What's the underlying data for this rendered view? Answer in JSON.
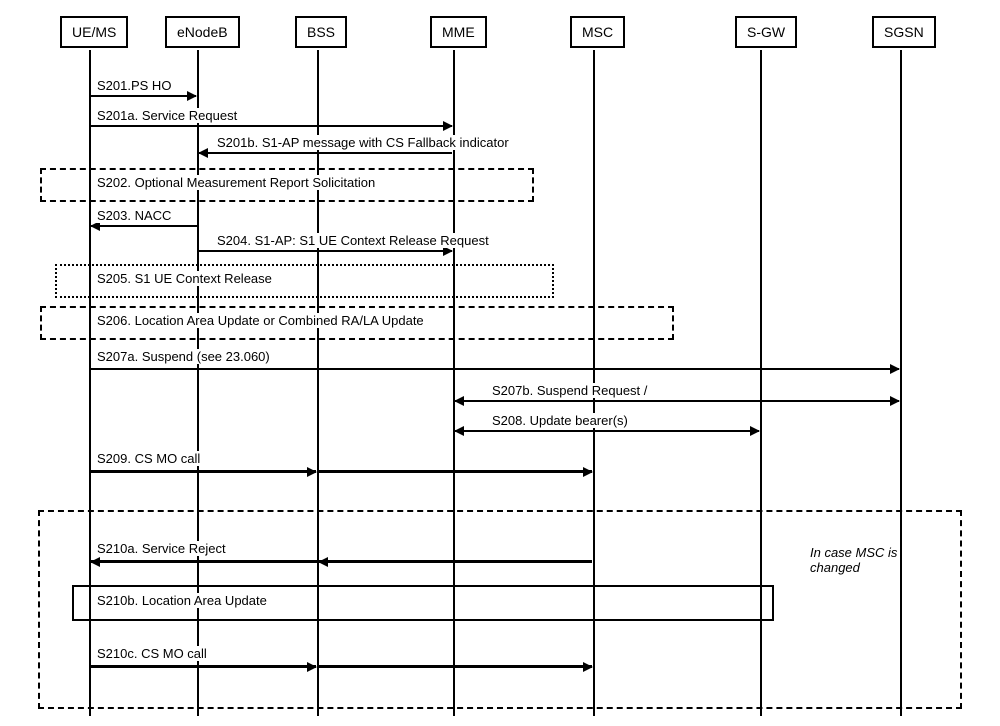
{
  "participants": {
    "ue": "UE/MS",
    "enb": "eNodeB",
    "bss": "BSS",
    "mme": "MME",
    "msc": "MSC",
    "sgw": "S-GW",
    "sgsn": "SGSN"
  },
  "messages": {
    "s201": "S201.PS HO",
    "s201a": "S201a. Service Request",
    "s201b": "S201b. S1-AP message with CS Fallback indicator",
    "s202": "S202. Optional Measurement Report Solicitation",
    "s203": "S203. NACC",
    "s204": "S204. S1-AP: S1 UE Context Release Request",
    "s205": "S205. S1 UE Context Release",
    "s206": "S206. Location Area Update or Combined RA/LA Update",
    "s207a": "S207a. Suspend (see 23.060)",
    "s207b": "S207b. Suspend Request /",
    "s208": "S208. Update bearer(s)",
    "s209": "S209. CS MO call",
    "s210a": "S210a. Service Reject",
    "s210b": "S210b. Location Area Update",
    "s210c": "S210c. CS MO call"
  },
  "notes": {
    "msc_changed": "In case MSC is changed"
  },
  "chart_data": {
    "type": "sequence_diagram",
    "participants": [
      "UE/MS",
      "eNodeB",
      "BSS",
      "MME",
      "MSC",
      "S-GW",
      "SGSN"
    ],
    "interactions": [
      {
        "id": "S201",
        "from": "UE/MS",
        "to": "eNodeB",
        "label": "S201.PS HO",
        "direction": "right"
      },
      {
        "id": "S201a",
        "from": "UE/MS",
        "to": "MME",
        "label": "S201a. Service Request",
        "direction": "right",
        "via": "eNodeB"
      },
      {
        "id": "S201b",
        "from": "MME",
        "to": "eNodeB",
        "label": "S201b. S1-AP message with CS Fallback indicator",
        "direction": "left"
      },
      {
        "id": "S202",
        "box": true,
        "span": [
          "UE/MS",
          "MME"
        ],
        "label": "S202. Optional Measurement Report Solicitation",
        "style": "dashed"
      },
      {
        "id": "S203",
        "from": "eNodeB",
        "to": "UE/MS",
        "label": "S203. NACC",
        "direction": "left"
      },
      {
        "id": "S204",
        "from": "eNodeB",
        "to": "MME",
        "label": "S204. S1-AP: S1 UE Context Release Request",
        "direction": "right"
      },
      {
        "id": "S205",
        "box": true,
        "span": [
          "UE/MS",
          "MME"
        ],
        "label": "S205. S1 UE Context Release",
        "style": "dotted"
      },
      {
        "id": "S206",
        "box": true,
        "span": [
          "UE/MS",
          "MSC"
        ],
        "label": "S206. Location Area Update or Combined RA/LA Update",
        "style": "dashed"
      },
      {
        "id": "S207a",
        "from": "UE/MS",
        "to": "SGSN",
        "label": "S207a. Suspend (see 23.060)",
        "direction": "right"
      },
      {
        "id": "S207b",
        "from": "SGSN",
        "to": "MME",
        "label": "S207b. Suspend Request /",
        "direction": "bidir"
      },
      {
        "id": "S208",
        "from": "MME",
        "to": "S-GW",
        "label": "S208. Update bearer(s)",
        "direction": "bidir"
      },
      {
        "id": "S209",
        "from": "UE/MS",
        "to": "MSC",
        "label": "S209. CS MO call",
        "direction": "right",
        "via": "BSS",
        "thick": true
      },
      {
        "id": "block210",
        "box": true,
        "span": [
          "UE/MS",
          "S-GW"
        ],
        "style": "dashed",
        "note": "In case MSC is changed",
        "contains": [
          "S210a",
          "S210b",
          "S210c"
        ]
      },
      {
        "id": "S210a",
        "from": "MSC",
        "to": "UE/MS",
        "label": "S210a. Service Reject",
        "direction": "left",
        "via": "BSS",
        "thick": true
      },
      {
        "id": "S210b",
        "box": true,
        "span": [
          "UE/MS",
          "S-GW"
        ],
        "label": "S210b. Location Area Update",
        "style": "solid"
      },
      {
        "id": "S210c",
        "from": "UE/MS",
        "to": "MSC",
        "label": "S210c. CS MO call",
        "direction": "right",
        "via": "BSS",
        "thick": true
      }
    ]
  }
}
